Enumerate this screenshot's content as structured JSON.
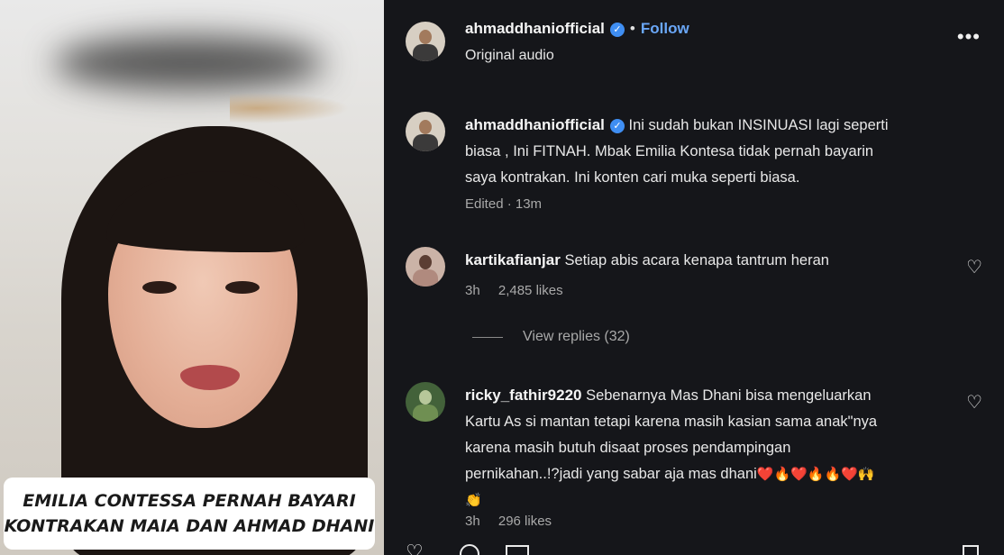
{
  "video": {
    "caption_line1": "EMILIA CONTESSA PERNAH BAYARI",
    "caption_line2": "KONTRAKAN MAIA DAN AHMAD DHANI"
  },
  "post": {
    "username": "ahmaddhaniofficial",
    "verified_mark": "✓",
    "separator": "•",
    "follow_label": "Follow",
    "audio_label": "Original audio",
    "more_label": "•••"
  },
  "comments": [
    {
      "username": "ahmaddhaniofficial",
      "verified": true,
      "lines": [
        "Ini sudah bukan INSINUASI lagi seperti",
        "biasa , Ini FITNAH. Mbak Emilia Kontesa tidak pernah bayarin",
        "saya kontrakan. Ini konten cari muka seperti biasa."
      ],
      "meta": "Edited · 13m"
    },
    {
      "username": "kartikafianjar",
      "lines": [
        "Setiap abis acara kenapa tantrum heran"
      ],
      "time": "3h",
      "likes": "2,485 likes",
      "view_replies": "View replies (32)"
    },
    {
      "username": "ricky_fathir9220",
      "lines": [
        "Sebenarnya Mas Dhani bisa mengeluarkan",
        "Kartu As si mantan tetapi karena masih kasian sama anak\"nya",
        "karena masih butuh disaat proses pendampingan",
        "pernikahan..!?jadi yang sabar aja mas dhani"
      ],
      "emojis": "❤️🔥❤️🔥🔥❤️🙌",
      "emoji_line2": "👏",
      "time": "3h",
      "likes": "296 likes"
    }
  ],
  "icons": {
    "heart": "♡",
    "verified": "verified-badge-icon",
    "more": "more-options-icon"
  },
  "colors": {
    "panel_bg": "#15161a",
    "follow": "#6aa7f8",
    "verified": "#3f8ef2",
    "muted": "#a9a9a9"
  }
}
